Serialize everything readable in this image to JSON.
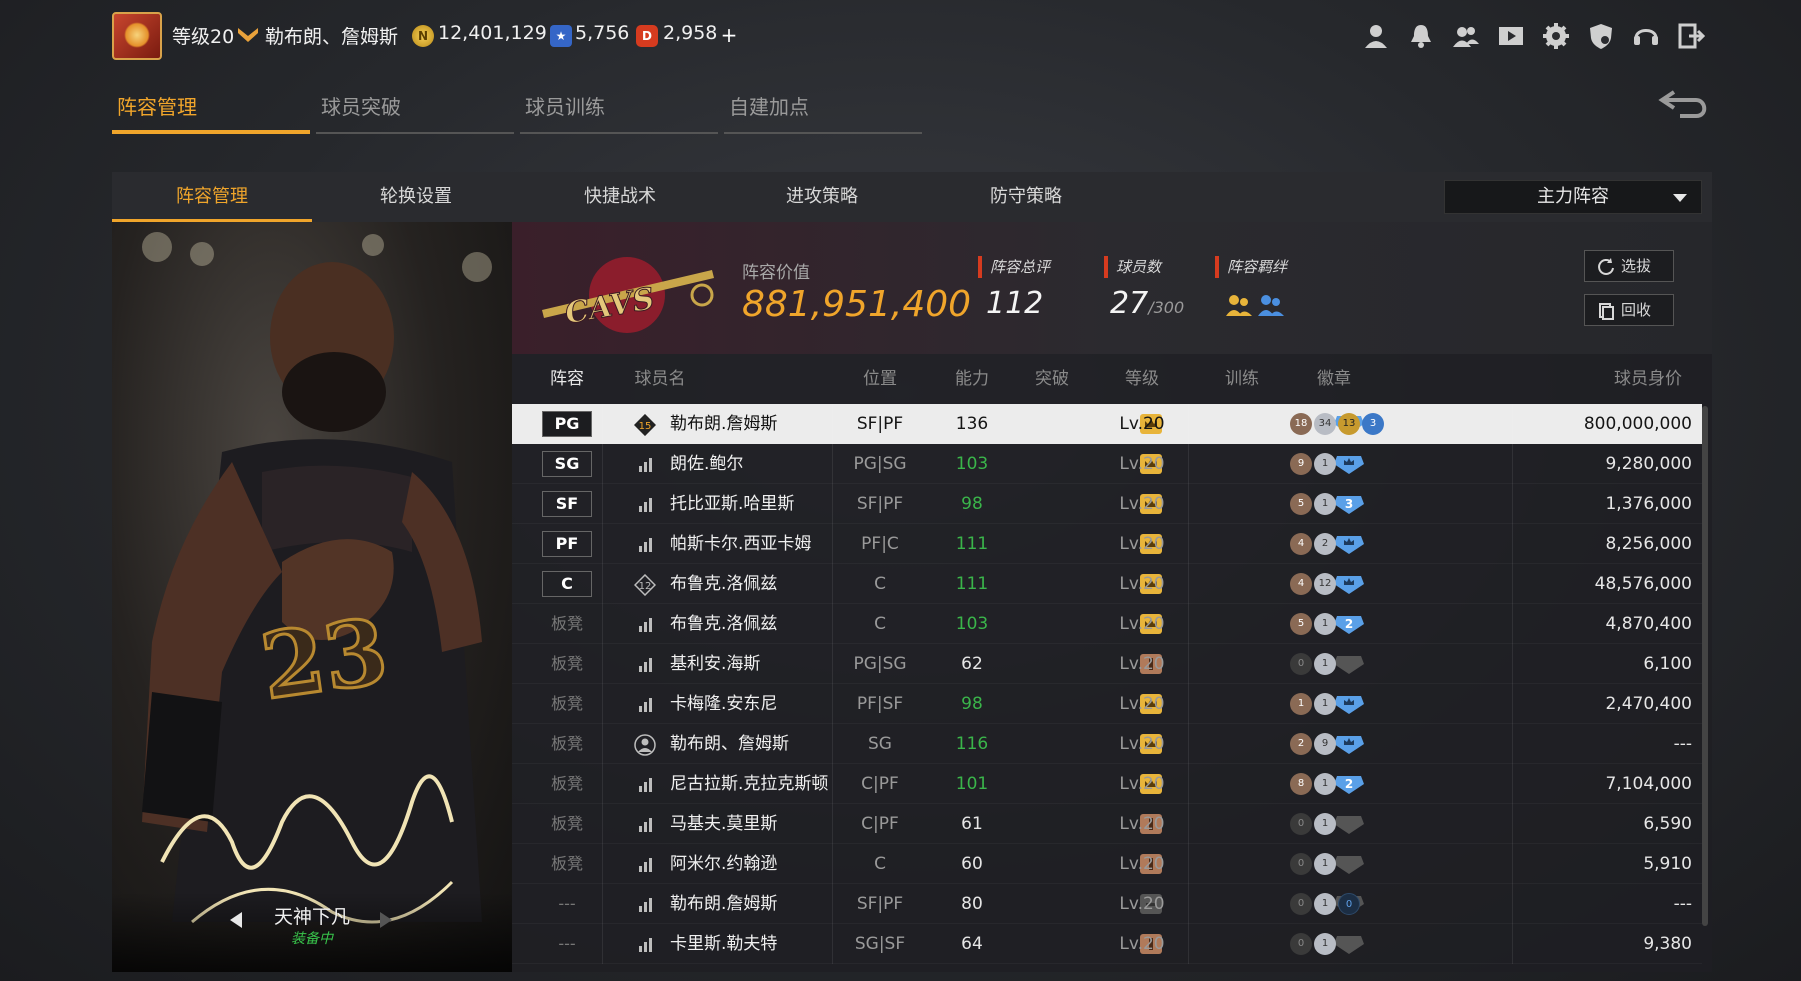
{
  "player": {
    "level": "等级20",
    "name": "勒布朗、詹姆斯",
    "coins": "12,401,129",
    "stars": "5,756",
    "tickets": "2,958",
    "coin_icon_glyph": "N",
    "star_icon_glyph": "★",
    "ticket_icon_glyph": "D"
  },
  "main_tabs": [
    "阵容管理",
    "球员突破",
    "球员训练",
    "自建加点"
  ],
  "sub_tabs": [
    "阵容管理",
    "轮换设置",
    "快捷战术",
    "进攻策略",
    "防守策略"
  ],
  "lineup_select": "主力阵容",
  "card": {
    "name": "天神下凡",
    "status": "装备中"
  },
  "team": {
    "value_label": "阵容价值",
    "value": "881,951,400",
    "rating_label": "阵容总评",
    "rating": "112",
    "players_label": "球员数",
    "players": "27",
    "players_max": "/300",
    "bond_label": "阵容羁绊",
    "draft_button": "选拔",
    "recycle_button": "回收"
  },
  "columns": [
    "阵容",
    "球员名",
    "位置",
    "能力",
    "突破",
    "等级",
    "训练",
    "徽章",
    "球员身价"
  ],
  "rows": [
    {
      "slot": "PG",
      "pos_box": true,
      "icon": "15",
      "name": "勒布朗.詹姆斯",
      "position": "SF|PF",
      "ability": "136",
      "ability_color": "white",
      "break": "gold",
      "level": "Lv.20",
      "train": "blue",
      "train_num": "",
      "badges": [
        [
          "18",
          "bronze"
        ],
        [
          "34",
          "silver"
        ],
        [
          "13",
          "goldb"
        ],
        [
          "3",
          "blueb"
        ]
      ],
      "value": "800,000,000"
    },
    {
      "slot": "SG",
      "pos_box": true,
      "icon": "bars",
      "name": "朗佐.鲍尔",
      "position": "PG|SG",
      "ability": "103",
      "ability_color": "green",
      "break": "gold",
      "level": "Lv.20",
      "train": "blue",
      "train_num": "",
      "badges": [
        [
          "9",
          "bronze"
        ],
        [
          "1",
          "silver"
        ]
      ],
      "value": "9,280,000"
    },
    {
      "slot": "SF",
      "pos_box": true,
      "icon": "bars",
      "name": "托比亚斯.哈里斯",
      "position": "SF|PF",
      "ability": "98",
      "ability_color": "green",
      "break": "gold",
      "level": "Lv.20",
      "train": "blue",
      "train_num": "3",
      "badges": [
        [
          "5",
          "bronze"
        ],
        [
          "1",
          "silver"
        ]
      ],
      "value": "1,376,000"
    },
    {
      "slot": "PF",
      "pos_box": true,
      "icon": "bars",
      "name": "帕斯卡尔.西亚卡姆",
      "position": "PF|C",
      "ability": "111",
      "ability_color": "green",
      "break": "gold",
      "level": "Lv.20",
      "train": "blue",
      "train_num": "",
      "badges": [
        [
          "4",
          "bronze"
        ],
        [
          "2",
          "silver"
        ]
      ],
      "value": "8,256,000"
    },
    {
      "slot": "C",
      "pos_box": true,
      "icon": "12",
      "name": "布鲁克.洛佩兹",
      "position": "C",
      "ability": "111",
      "ability_color": "green",
      "break": "gold",
      "level": "Lv.20",
      "train": "blue",
      "train_num": "",
      "badges": [
        [
          "4",
          "bronze"
        ],
        [
          "12",
          "silver"
        ]
      ],
      "value": "48,576,000"
    },
    {
      "slot": "板凳",
      "pos_box": false,
      "icon": "bars",
      "name": "布鲁克.洛佩兹",
      "position": "C",
      "ability": "103",
      "ability_color": "green",
      "break": "gold",
      "level": "Lv.20",
      "train": "blue",
      "train_num": "2",
      "badges": [
        [
          "5",
          "bronze"
        ],
        [
          "1",
          "silver"
        ]
      ],
      "value": "4,870,400"
    },
    {
      "slot": "板凳",
      "pos_box": false,
      "icon": "bars",
      "name": "基利安.海斯",
      "position": "PG|SG",
      "ability": "62",
      "ability_color": "white",
      "break": "bronze",
      "level": "Lv.20",
      "train": "gray",
      "train_num": "",
      "badges": [
        [
          "0",
          "darkb"
        ],
        [
          "1",
          "silver"
        ]
      ],
      "value": "6,100"
    },
    {
      "slot": "板凳",
      "pos_box": false,
      "icon": "bars",
      "name": "卡梅隆.安东尼",
      "position": "PF|SF",
      "ability": "98",
      "ability_color": "green",
      "break": "gold",
      "level": "Lv.20",
      "train": "blue",
      "train_num": "",
      "badges": [
        [
          "1",
          "bronze"
        ],
        [
          "1",
          "silver"
        ]
      ],
      "value": "2,470,400"
    },
    {
      "slot": "板凳",
      "pos_box": false,
      "icon": "person",
      "name": "勒布朗、詹姆斯",
      "position": "SG",
      "ability": "116",
      "ability_color": "green",
      "break": "gold",
      "level": "Lv.20",
      "train": "blue",
      "train_num": "",
      "badges": [
        [
          "2",
          "bronze"
        ],
        [
          "9",
          "silver"
        ]
      ],
      "value": "---"
    },
    {
      "slot": "板凳",
      "pos_box": false,
      "icon": "bars",
      "name": "尼古拉斯.克拉克斯顿",
      "position": "C|PF",
      "ability": "101",
      "ability_color": "green",
      "break": "gold",
      "level": "Lv.20",
      "train": "blue",
      "train_num": "2",
      "badges": [
        [
          "8",
          "bronze"
        ],
        [
          "1",
          "silver"
        ]
      ],
      "value": "7,104,000"
    },
    {
      "slot": "板凳",
      "pos_box": false,
      "icon": "bars",
      "name": "马基夫.莫里斯",
      "position": "C|PF",
      "ability": "61",
      "ability_color": "white",
      "break": "bronze",
      "level": "Lv.20",
      "train": "gray",
      "train_num": "",
      "badges": [
        [
          "0",
          "darkb"
        ],
        [
          "1",
          "silver"
        ]
      ],
      "value": "6,590"
    },
    {
      "slot": "板凳",
      "pos_box": false,
      "icon": "bars",
      "name": "阿米尔.约翰逊",
      "position": "C",
      "ability": "60",
      "ability_color": "white",
      "break": "bronze",
      "level": "Lv.20",
      "train": "gray",
      "train_num": "",
      "badges": [
        [
          "0",
          "darkb"
        ],
        [
          "1",
          "silver"
        ]
      ],
      "value": "5,910"
    },
    {
      "slot": "---",
      "pos_box": false,
      "icon": "bars",
      "name": "勒布朗.詹姆斯",
      "position": "SF|PF",
      "ability": "80",
      "ability_color": "white",
      "break": "gray",
      "level": "Lv.20",
      "train": "gray",
      "train_num": "",
      "badges": [
        [
          "0",
          "darkb"
        ],
        [
          "1",
          "silver"
        ],
        [
          "0",
          "navyb"
        ]
      ],
      "value": "---"
    },
    {
      "slot": "---",
      "pos_box": false,
      "icon": "bars",
      "name": "卡里斯.勒夫特",
      "position": "SG|SF",
      "ability": "64",
      "ability_color": "white",
      "break": "bronze",
      "level": "Lv.20",
      "train": "gray",
      "train_num": "",
      "badges": [
        [
          "0",
          "darkb"
        ],
        [
          "1",
          "silver"
        ]
      ],
      "value": "9,380"
    }
  ],
  "colors": {
    "accent": "#f0a52b",
    "green": "#3ab54a",
    "selected_row": "#ececec"
  }
}
